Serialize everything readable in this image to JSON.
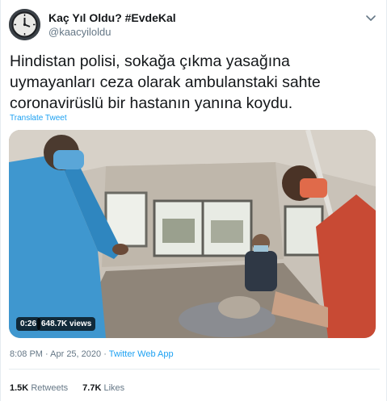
{
  "author": {
    "name": "Kaç Yıl Oldu? #EvdeKal",
    "handle": "@kaacyiloldu"
  },
  "tweet": {
    "text": "Hindistan polisi, sokağa çıkma yasağına uymayanları ceza olarak ambulanstaki sahte coronavirüslü bir hastanın yanına koydu.",
    "translate_label": "Translate Tweet"
  },
  "video": {
    "duration": "0:26",
    "views": "648.7K views"
  },
  "meta": {
    "time": "8:08 PM",
    "separator": " · ",
    "date": "Apr 25, 2020",
    "source": "Twitter Web App"
  },
  "stats": {
    "retweets_count": "1.5K",
    "retweets_label": "Retweets",
    "likes_count": "7.7K",
    "likes_label": "Likes"
  },
  "colors": {
    "link": "#1da1f2",
    "secondary_text": "#657786",
    "primary_text": "#14171a",
    "divider": "#e6ecf0"
  },
  "icons": [
    "clock-avatar-icon",
    "chevron-down-icon"
  ]
}
